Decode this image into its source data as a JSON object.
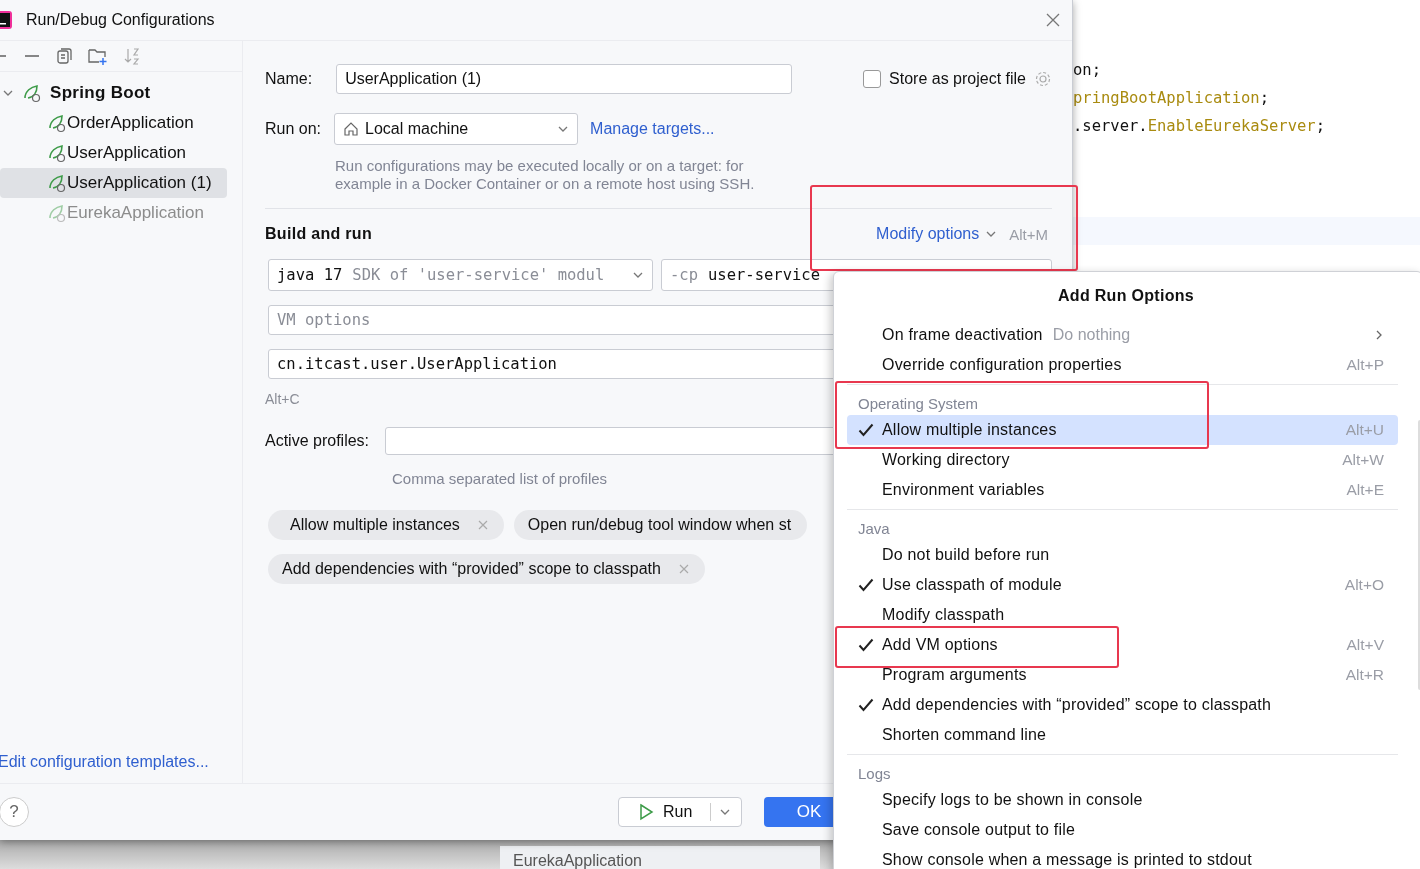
{
  "window": {
    "title": "Run/Debug Configurations"
  },
  "tree": {
    "label": "Spring Boot",
    "expanded": true,
    "children": [
      {
        "label": "OrderApplication",
        "selected": false,
        "dimmed": false
      },
      {
        "label": "UserApplication",
        "selected": false,
        "dimmed": false
      },
      {
        "label": "UserApplication (1)",
        "selected": true,
        "dimmed": false
      },
      {
        "label": "EurekaApplication",
        "selected": false,
        "dimmed": true
      }
    ]
  },
  "edit_templates_link": "Edit configuration templates...",
  "name_field": {
    "label": "Name:",
    "value": "UserApplication (1)"
  },
  "store_as_project_file": {
    "label": "Store as project file",
    "checked": false
  },
  "run_on": {
    "label": "Run on:",
    "value": "Local machine",
    "link": "Manage targets...",
    "hint": "Run configurations may be executed locally or on a target: for example in a Docker Container or on a remote host using SSH."
  },
  "build_and_run": {
    "title": "Build and run",
    "modify_options": {
      "label": "Modify options",
      "shortcut": "Alt+M",
      "highlighted": true
    },
    "jre": {
      "value": "java 17",
      "hint": "SDK of 'user-service' modul"
    },
    "classpath": {
      "prefix": "-cp",
      "value": "user-service"
    },
    "vm_options": {
      "placeholder": "VM options"
    },
    "main_class": {
      "value": "cn.itcast.user.UserApplication",
      "shortcut": "Alt+C"
    }
  },
  "active_profiles": {
    "label": "Active profiles:",
    "hint": "Comma separated list of profiles"
  },
  "option_chips": [
    {
      "label": "Allow multiple instances",
      "removable": true
    },
    {
      "label": "Open run/debug tool window when st",
      "removable": false
    },
    {
      "label": "Add dependencies with “provided” scope to classpath",
      "removable": true
    }
  ],
  "footer": {
    "help_button": "?",
    "run_button": "Run",
    "ok_button": "OK"
  },
  "editor": {
    "lines": [
      [
        {
          "kind": "plain",
          "text": "on;"
        }
      ],
      [
        {
          "kind": "class",
          "text": "pringBootApplication"
        },
        {
          "kind": "plain",
          "text": ";"
        }
      ],
      [
        {
          "kind": "plain",
          "text": ".server."
        },
        {
          "kind": "class",
          "text": "EnableEurekaServer"
        },
        {
          "kind": "plain",
          "text": ";"
        }
      ]
    ]
  },
  "bottom_tab": "EurekaApplication",
  "popup": {
    "title": "Add Run Options",
    "groups": [
      {
        "items": [
          {
            "text": "On frame deactivation",
            "value": "Do nothing",
            "submenu": true,
            "checked": false,
            "selected": false
          },
          {
            "text": "Override configuration properties",
            "shortcut": "Alt+P",
            "checked": false,
            "selected": false
          }
        ]
      },
      {
        "header": "Operating System",
        "items": [
          {
            "text": "Allow multiple instances",
            "shortcut": "Alt+U",
            "checked": true,
            "selected": true,
            "highlighted": true
          },
          {
            "text": "Working directory",
            "shortcut": "Alt+W",
            "checked": false,
            "selected": false
          },
          {
            "text": "Environment variables",
            "shortcut": "Alt+E",
            "checked": false,
            "selected": false
          }
        ]
      },
      {
        "header": "Java",
        "items": [
          {
            "text": "Do not build before run",
            "checked": false,
            "selected": false
          },
          {
            "text": "Use classpath of module",
            "shortcut": "Alt+O",
            "checked": true,
            "selected": false
          },
          {
            "text": "Modify classpath",
            "checked": false,
            "selected": false
          },
          {
            "text": "Add VM options",
            "shortcut": "Alt+V",
            "checked": true,
            "selected": false,
            "highlighted": true
          },
          {
            "text": "Program arguments",
            "shortcut": "Alt+R",
            "checked": false,
            "selected": false
          },
          {
            "text": "Add dependencies with “provided” scope to classpath",
            "checked": true,
            "selected": false
          },
          {
            "text": "Shorten command line",
            "checked": false,
            "selected": false
          }
        ]
      },
      {
        "header": "Logs",
        "items": [
          {
            "text": "Specify logs to be shown in console",
            "checked": false,
            "selected": false
          },
          {
            "text": "Save console output to file",
            "checked": false,
            "selected": false
          },
          {
            "text": "Show console when a message is printed to stdout",
            "checked": false,
            "selected": false
          }
        ]
      }
    ]
  }
}
